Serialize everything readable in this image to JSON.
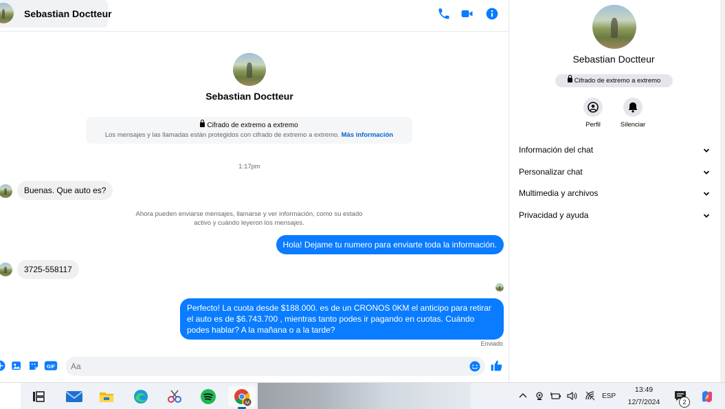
{
  "header": {
    "contact_name": "Sebastian Doctteur"
  },
  "intro": {
    "name": "Sebastian Doctteur",
    "e2e_title": "Cifrado de extremo a extremo",
    "e2e_desc": "Los mensajes y las llamadas están protegidos con cifrado de extremo a extremo.",
    "e2e_link": "Más información"
  },
  "conversation": {
    "time_separator": "1:17pm",
    "notice": "Ahora pueden enviarse mensajes, llamarse y ver información, como su estado activo y cuándo leyeron los mensajes.",
    "messages": [
      {
        "direction": "incoming",
        "text": "Buenas. Que auto es?"
      },
      {
        "direction": "outgoing",
        "text": "Hola! Dejame tu numero  para enviarte toda la información."
      },
      {
        "direction": "incoming",
        "text": "3725-558117"
      },
      {
        "direction": "outgoing",
        "text": "Perfecto! La cuota desde $188.000. es de un CRONOS 0KM el anticipo para retirar el auto es de $6.743.700 , mientras tanto podes ir pagando en cuotas. Cuándo podes hablar? A la mañana o a la tarde?"
      }
    ],
    "status": "Enviado"
  },
  "composer": {
    "placeholder": "Aa",
    "gif_label": "GIF"
  },
  "info_panel": {
    "name": "Sebastian Doctteur",
    "badge": "Cifrado de extremo a extremo",
    "actions": [
      {
        "label": "Perfil",
        "icon": "profile-icon"
      },
      {
        "label": "Silenciar",
        "icon": "bell-icon"
      }
    ],
    "sections": [
      {
        "label": "Información del chat"
      },
      {
        "label": "Personalizar chat"
      },
      {
        "label": "Multimedia y archivos"
      },
      {
        "label": "Privacidad y ayuda"
      }
    ]
  },
  "taskbar": {
    "apps": [
      "task-view-icon",
      "mail-icon",
      "file-explorer-icon",
      "edge-icon",
      "snipping-tool-icon",
      "spotify-icon",
      "chrome-icon"
    ],
    "chrome_badge": "M",
    "language": "ESP",
    "time": "13:49",
    "date": "12/7/2024",
    "notification_count": "2"
  },
  "colors": {
    "accent": "#0a7cff",
    "link": "#0064d1",
    "incoming_bubble": "#f0f0f0"
  }
}
